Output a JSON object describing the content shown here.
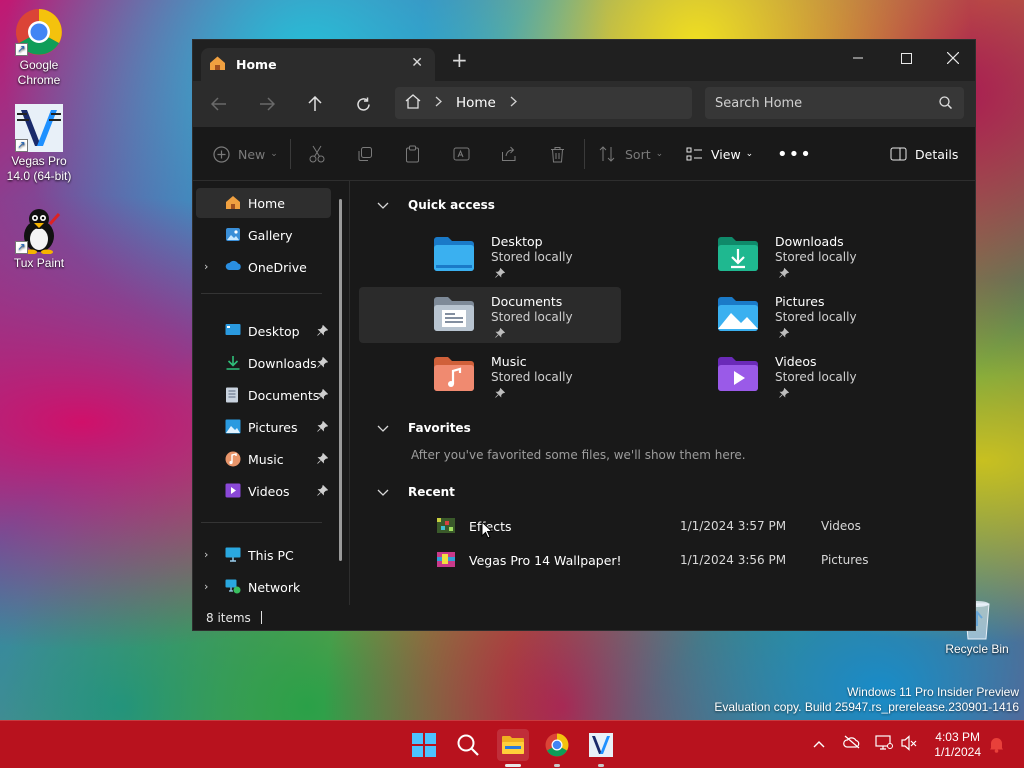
{
  "desktop": {
    "icons": [
      {
        "label": "Google Chrome",
        "icon": "chrome-icon"
      },
      {
        "label": "Vegas Pro 14.0 (64-bit)",
        "icon": "vegas-pro-icon"
      },
      {
        "label": "Tux Paint",
        "icon": "tux-paint-icon"
      },
      {
        "label": "Recycle Bin",
        "icon": "recycle-bin-icon"
      }
    ],
    "watermark_line1": "Windows 11 Pro Insider Preview",
    "watermark_line2": "Evaluation copy. Build 25947.rs_prerelease.230901-1416"
  },
  "window": {
    "tab_title": "Home",
    "address": {
      "crumb": "Home"
    },
    "search": {
      "placeholder": "Search Home"
    },
    "toolbar": {
      "new_label": "New",
      "sort_label": "Sort",
      "view_label": "View",
      "details_label": "Details"
    },
    "sidebar": {
      "items": [
        {
          "label": "Home",
          "icon": "home-icon"
        },
        {
          "label": "Gallery",
          "icon": "gallery-icon"
        },
        {
          "label": "OneDrive",
          "icon": "onedrive-icon"
        },
        {
          "label": "Desktop",
          "icon": "desktop-folder-icon"
        },
        {
          "label": "Downloads",
          "icon": "downloads-folder-icon"
        },
        {
          "label": "Documents",
          "icon": "documents-folder-icon"
        },
        {
          "label": "Pictures",
          "icon": "pictures-folder-icon"
        },
        {
          "label": "Music",
          "icon": "music-folder-icon"
        },
        {
          "label": "Videos",
          "icon": "videos-folder-icon"
        },
        {
          "label": "This PC",
          "icon": "this-pc-icon"
        },
        {
          "label": "Network",
          "icon": "network-icon"
        }
      ]
    },
    "quick_access": {
      "title": "Quick access",
      "items": [
        {
          "name": "Desktop",
          "status": "Stored locally"
        },
        {
          "name": "Downloads",
          "status": "Stored locally"
        },
        {
          "name": "Documents",
          "status": "Stored locally"
        },
        {
          "name": "Pictures",
          "status": "Stored locally"
        },
        {
          "name": "Music",
          "status": "Stored locally"
        },
        {
          "name": "Videos",
          "status": "Stored locally"
        }
      ]
    },
    "favorites": {
      "title": "Favorites",
      "empty_text": "After you've favorited some files, we'll show them here."
    },
    "recent": {
      "title": "Recent",
      "items": [
        {
          "name": "Effects",
          "date": "1/1/2024 3:57 PM",
          "location": "Videos"
        },
        {
          "name": "Vegas Pro 14 Wallpaper!",
          "date": "1/1/2024 3:56 PM",
          "location": "Pictures"
        }
      ]
    },
    "status": {
      "item_count": "8 items"
    }
  },
  "taskbar": {
    "apps": [
      "start-icon",
      "search-icon",
      "file-explorer-icon",
      "chrome-icon",
      "vegas-pro-icon"
    ],
    "clock": {
      "time": "4:03 PM",
      "date": "1/1/2024"
    },
    "colors": {
      "taskbar_bg": "#b8121e",
      "window_bg": "#191919"
    }
  }
}
